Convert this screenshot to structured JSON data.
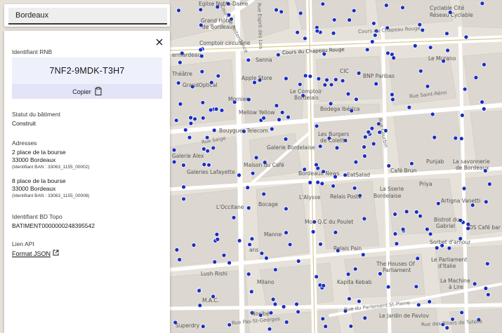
{
  "search": {
    "value": "Bordeaux"
  },
  "panel": {
    "rnb_title": "Identifiant RNB",
    "rnb_id": "7NF2-9MDK-T3H7",
    "copy_label": "Copier",
    "status_title": "Statut du bâtiment",
    "status_value": "Construit",
    "addresses_title": "Adresses",
    "addresses": [
      {
        "line1": "2 place de la bourse",
        "line2": "33000 Bordeaux",
        "ban": "(Identifiant BAN : 33063_1155_00002)"
      },
      {
        "line1": "8 place de la bourse",
        "line2": "33000 Bordeaux",
        "ban": "(Identifiant BAN : 33063_1155_00008)"
      }
    ],
    "bdtopo_title": "Identifiant BD Topo",
    "bdtopo_value": "BATIMENT0000000248395542",
    "api_title": "Lien API",
    "api_link": "Format JSON"
  },
  "map_labels": {
    "eglise": "Eglise Notre-Dame",
    "grand_hotel": "Grand Hôtel",
    "de_bordeaux": "de Bordeaux",
    "circuit": "Comptoir circuisine",
    "ermardeau": "ermardeau",
    "theatre": "Théâtre",
    "grandoptical": "GrandOptical",
    "cours_intendance": "Cours de l'Intendance",
    "rue_esprit": "Rue Esprit des Lois",
    "cyclable1": "Cyclable Cité",
    "cyclable2": "Réseau Cyclable",
    "cours_chapeau": "Cours du Chapeau Rouge",
    "cours_chapeau2": "Cours du Chapeau Rouge",
    "sanna": "Sanna",
    "cic": "CIC",
    "bnp": "BNP Paribas",
    "le_murano": "Le Murano",
    "apple_store": "Apple Store",
    "comptoir": "Le Comptoir",
    "comptoir2": "Bordelais",
    "mornier": "Mornier",
    "mellow": "Mellow Yellow",
    "bodega": "Bodega Ibérica",
    "bouygues": "Bouygues Telecom",
    "rue_saige": "Rue Saige",
    "galerie_bordelaise": "Galerie Bordelaise",
    "burgers": "Les Burgers",
    "burgers2": "de Colette",
    "rue_courbin": "Rue Courbin",
    "galerie_alex": "Galerie Alex",
    "maison_cafe": "Maison du Café",
    "galeries_lafayette": "Galeries Lafayette",
    "bordeaux_news": "Bordeaux News",
    "punjab": "Punjab",
    "savonnerie": "La savonnerie",
    "savonnerie2": "de Bordeaux",
    "cafe_brun": "Café Brun",
    "eatsalad": "EatSalad",
    "priya": "Priya",
    "lalysse": "L'Alysse",
    "relais_poste": "Relais Poste",
    "lasserie": "La Sserie",
    "bordelaise": "Bordelaise",
    "occitane": "L'Occitane",
    "bocage": "Bocage",
    "artigna": "Artigna Vanetti",
    "bistrot": "Bistrot du",
    "bistrot2": "Gabriel",
    "ds_cafe": "DS Café bar",
    "mon_qc": "Mon Q.C du Poulet",
    "manne": "Manne",
    "relais_pain": "Relais Pain",
    "sorbet": "Sorbet d'amour",
    "parliament": "Le Parliament",
    "parliament2": "d'Italie",
    "houses_parliament": "The Houses Of",
    "houses_parliament2": "Parliament",
    "lush": "Lush Rishi",
    "milano": "Milano",
    "kapita": "Kapita Kebab",
    "machine": "La Machine",
    "machine2": "à Lire",
    "mac": "M.A.C.",
    "nocibe": "Nocibé",
    "jardin_pavlov": "Le Jardin de Pavlov",
    "superdry": "Superdry",
    "rue_pas": "Rue Pas-St-Georges",
    "rue_parlement": "Rue du Parlement St-Pierre",
    "rue_piliers": "Rue des Piliers de Tutelle",
    "rue_saint_remi": "Rue Saint-Rémi",
    "ans": "ans"
  },
  "colors": {
    "marker": "#1c2fbf",
    "building": "#dcd7d0",
    "road": "#ffffff",
    "background": "#f2efe9"
  }
}
